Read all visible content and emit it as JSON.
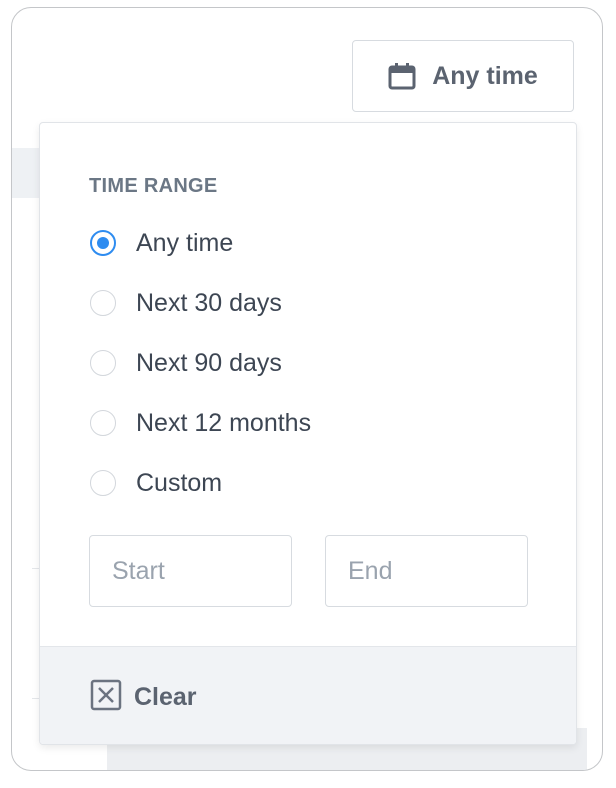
{
  "trigger": {
    "label": "Any time",
    "icon": "calendar-icon"
  },
  "time_range": {
    "title": "TIME RANGE",
    "selected": "Any time",
    "options": [
      {
        "label": "Any time",
        "checked": true
      },
      {
        "label": "Next 30 days",
        "checked": false
      },
      {
        "label": "Next 90 days",
        "checked": false
      },
      {
        "label": "Next 12 months",
        "checked": false
      },
      {
        "label": "Custom",
        "checked": false
      }
    ]
  },
  "custom": {
    "start_placeholder": "Start",
    "end_placeholder": "End",
    "start_value": "",
    "end_value": ""
  },
  "footer": {
    "clear_label": "Clear",
    "clear_icon": "close-box-icon"
  },
  "colors": {
    "accent": "#2e8cf0",
    "text": "#3d4653",
    "muted": "#6b7785",
    "footer_bg": "#f1f3f6"
  }
}
